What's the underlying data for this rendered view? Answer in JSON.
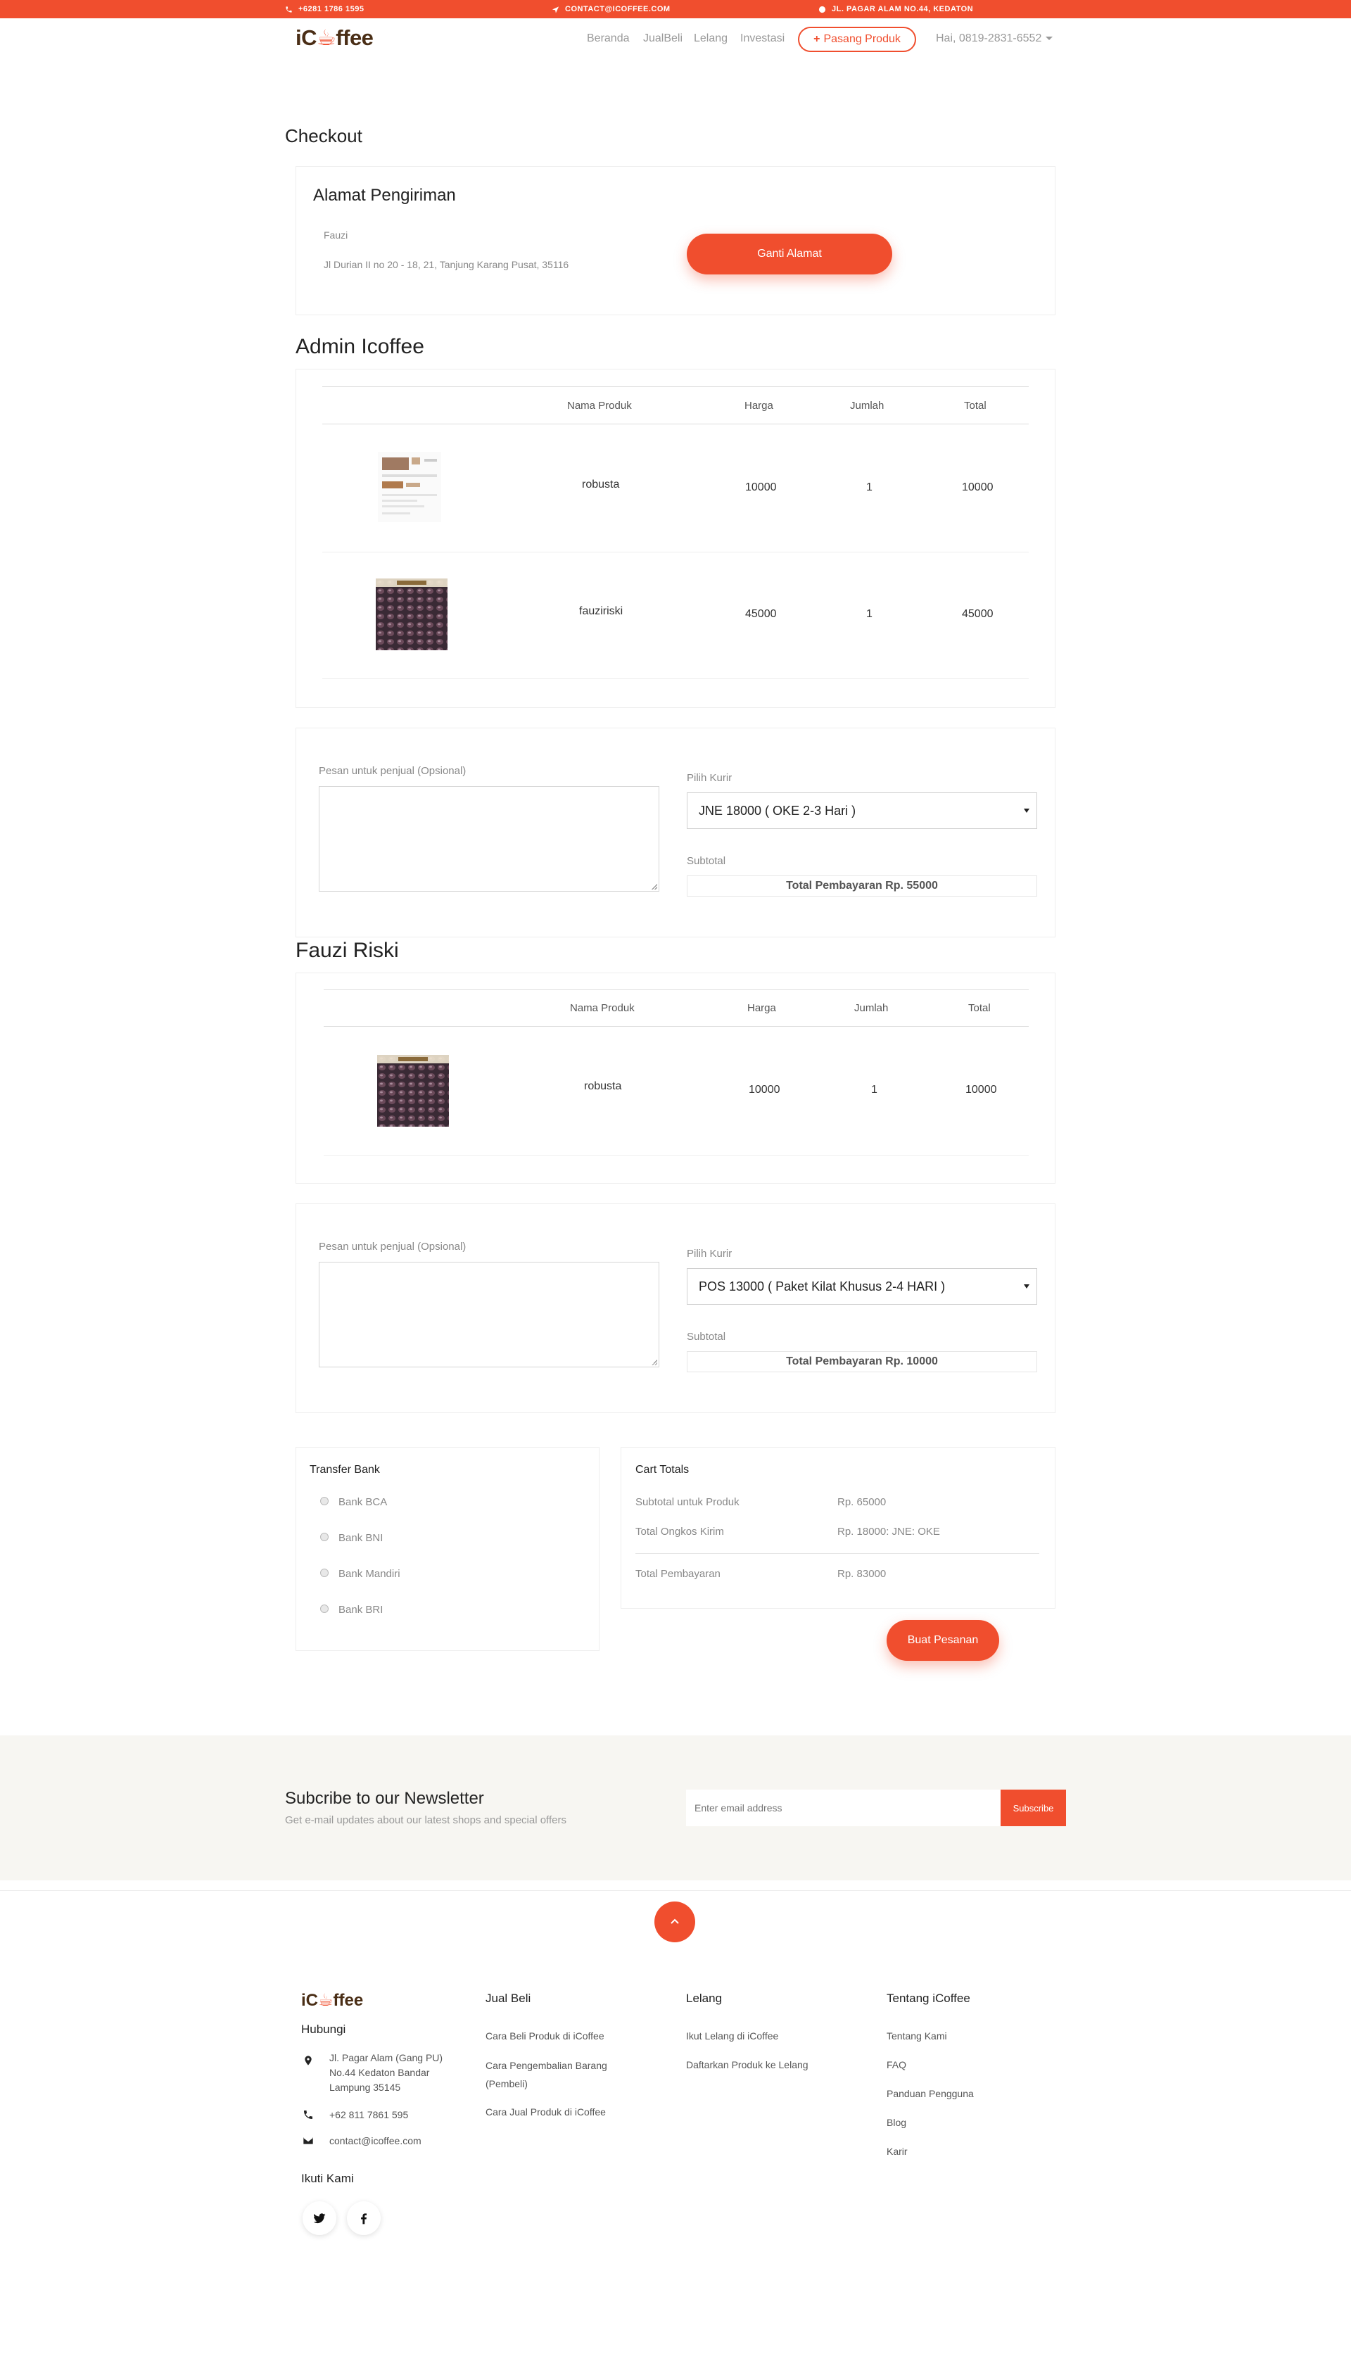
{
  "topbar": {
    "phone": "+6281 1786 1595",
    "email": "CONTACT@ICOFFEE.COM",
    "address": "JL. PAGAR ALAM NO.44, KEDATON"
  },
  "header": {
    "logo_prefix": "iC",
    "logo_suffix": "ffee",
    "nav": [
      "Beranda",
      "JualBeli",
      "Lelang",
      "Investasi"
    ],
    "pasang_label": "Pasang Produk",
    "user_label": "Hai, 0819-2831-6552"
  },
  "page_title": "Checkout",
  "shipping": {
    "title": "Alamat Pengiriman",
    "name": "Fauzi",
    "address": "Jl Durian II no 20 - 18, 21, Tanjung Karang Pusat, 35116",
    "change_button": "Ganti Alamat"
  },
  "sellers": [
    {
      "name": "Admin Icoffee",
      "columns": [
        "Nama Produk",
        "Harga",
        "Jumlah",
        "Total"
      ],
      "items": [
        {
          "name": "robusta",
          "price": "10000",
          "qty": "1",
          "total": "10000"
        },
        {
          "name": "fauziriski",
          "price": "45000",
          "qty": "1",
          "total": "45000"
        }
      ],
      "note_label": "Pesan untuk penjual (Opsional)",
      "courier_label": "Pilih Kurir",
      "courier_value": "JNE 18000 ( OKE 2-3 Hari )",
      "subtotal_label": "Subtotal",
      "subtotal_value": "Total Pembayaran Rp. 55000"
    },
    {
      "name": "Fauzi Riski",
      "columns": [
        "Nama Produk",
        "Harga",
        "Jumlah",
        "Total"
      ],
      "items": [
        {
          "name": "robusta",
          "price": "10000",
          "qty": "1",
          "total": "10000"
        }
      ],
      "note_label": "Pesan untuk penjual (Opsional)",
      "courier_label": "Pilih Kurir",
      "courier_value": "POS 13000 ( Paket Kilat Khusus 2-4 HARI )",
      "subtotal_label": "Subtotal",
      "subtotal_value": "Total Pembayaran Rp. 10000"
    }
  ],
  "payment": {
    "title": "Transfer Bank",
    "options": [
      "Bank BCA",
      "Bank BNI",
      "Bank Mandiri",
      "Bank BRI"
    ]
  },
  "cart_totals": {
    "title": "Cart Totals",
    "subtotal_label": "Subtotal untuk Produk",
    "subtotal_value": "Rp. 65000",
    "shipping_label": "Total Ongkos Kirim",
    "shipping_value": "Rp. 18000: JNE: OKE",
    "total_label": "Total Pembayaran",
    "total_value": "Rp. 83000",
    "order_button": "Buat Pesanan"
  },
  "newsletter": {
    "title": "Subcribe to our Newsletter",
    "subtitle": "Get e-mail updates about our latest shops and special offers",
    "placeholder": "Enter email address",
    "button": "Subscribe"
  },
  "footer": {
    "logo_prefix": "iC",
    "logo_suffix": "ffee",
    "contact_title": "Hubungi",
    "address": "Jl. Pagar Alam (Gang PU) No.44 Kedaton Bandar Lampung 35145",
    "phone": "+62 811 7861 595",
    "email": "contact@icoffee.com",
    "follow_title": "Ikuti Kami",
    "columns": [
      {
        "title": "Jual Beli",
        "links": [
          "Cara Beli Produk di iCoffee",
          "Cara Pengembalian Barang (Pembeli)",
          "Cara Jual Produk di iCoffee"
        ]
      },
      {
        "title": "Lelang",
        "links": [
          "Ikut Lelang di iCoffee",
          "Daftarkan Produk ke Lelang"
        ]
      },
      {
        "title": "Tentang iCoffee",
        "links": [
          "Tentang Kami",
          "FAQ",
          "Panduan Pengguna",
          "Blog",
          "Karir"
        ]
      }
    ]
  },
  "colors": {
    "accent": "#f04e2e",
    "brand_brown": "#4a2e16"
  }
}
